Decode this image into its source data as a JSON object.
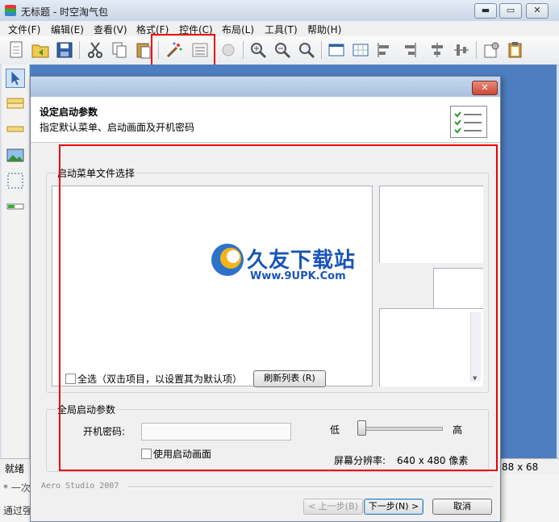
{
  "main_window": {
    "title": "无标题 - 时空淘气包",
    "controls": {
      "minimize": "▬",
      "maximize": "▭",
      "close": "✕"
    }
  },
  "menu": [
    {
      "label": "文件(F)"
    },
    {
      "label": "编辑(E)"
    },
    {
      "label": "查看(V)"
    },
    {
      "label": "格式(F)"
    },
    {
      "label": "控件(C)"
    },
    {
      "label": "布局(L)"
    },
    {
      "label": "工具(T)"
    },
    {
      "label": "帮助(H)"
    }
  ],
  "status": {
    "left": "就绪",
    "right": "88 x 68"
  },
  "background_hints": {
    "line1": "* 一次",
    "line2": "通过强"
  },
  "dialog": {
    "close_label": "✕",
    "header_title": "设定启动参数",
    "header_subtitle": "指定默认菜单、启动画面及开机密码",
    "group_file": {
      "label": "启动菜单文件选择",
      "select_all": "全选（双击项目，以设置其为默认项）",
      "refresh_button": "刷新列表 (R)"
    },
    "group_global": {
      "label": "全局启动参数",
      "password_label": "开机密码:",
      "password_value": "",
      "use_splash": "使用启动画面",
      "slider_low": "低",
      "slider_high": "高",
      "slider_level": 0.0,
      "resolution_label": "屏幕分辨率:",
      "resolution_value": "640 x 480 像素"
    },
    "footer": {
      "brand": "Aero Studio 2007",
      "prev": "< 上一步(B)",
      "next": "下一步(N) >",
      "cancel": "取消"
    }
  },
  "watermark": {
    "text": "久友下载站",
    "url": "Www.9UPK.Com"
  },
  "colors": {
    "canvas": "#4d7ec0",
    "highlight": "#e00000",
    "watermark": "#1a56b8"
  }
}
